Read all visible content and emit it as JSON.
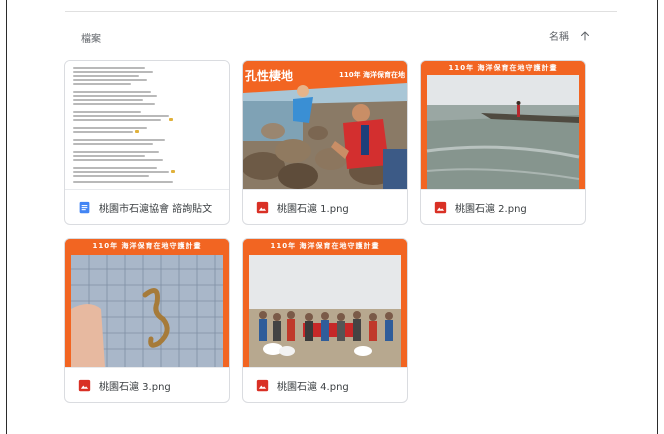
{
  "folder_label": "檔案",
  "sort": {
    "label": "名稱",
    "direction": "ascending",
    "icon": "arrow-up-icon"
  },
  "files": [
    {
      "name": "桃園市石滬協會 諮詢貼文",
      "type": "document",
      "icon": "docs-icon",
      "icon_color": "#4285f4"
    },
    {
      "name": "桃園石滬 1.png",
      "type": "image",
      "icon": "image-icon",
      "icon_color": "#d93025",
      "banner_left": "孔性棲地",
      "banner_right": "110年 海洋保育在地"
    },
    {
      "name": "桃園石滬 2.png",
      "type": "image",
      "icon": "image-icon",
      "icon_color": "#d93025",
      "banner": "110年 海洋保育在地守護計畫"
    },
    {
      "name": "桃園石滬 3.png",
      "type": "image",
      "icon": "image-icon",
      "icon_color": "#d93025",
      "banner": "110年 海洋保育在地守護計畫"
    },
    {
      "name": "桃園石滬 4.png",
      "type": "image",
      "icon": "image-icon",
      "icon_color": "#d93025",
      "banner": "110年 海洋保育在地守護計畫"
    }
  ],
  "colors": {
    "banner_orange": "#f26522",
    "border": "#dadce0"
  }
}
